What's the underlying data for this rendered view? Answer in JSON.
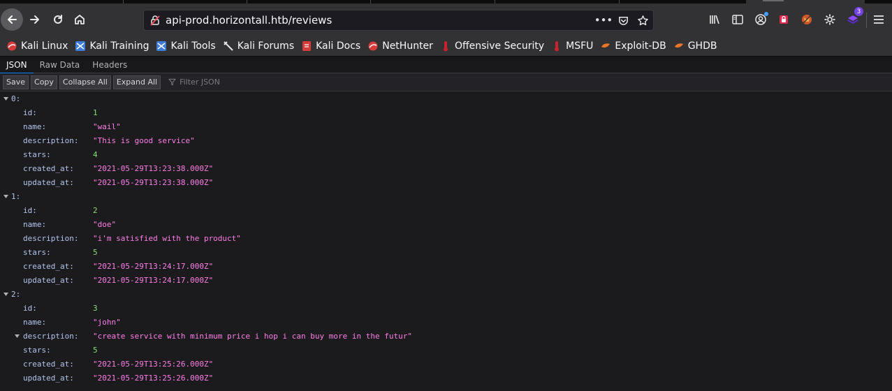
{
  "browser": {
    "url": "api-prod.horizontall.htb/reviews",
    "page_actions": [
      "more-icon",
      "pocket-icon",
      "bookmark-star-icon"
    ],
    "extension_badge": "3"
  },
  "bookmarks": [
    {
      "label": "Kali Linux",
      "icon": "kali-dragon-icon"
    },
    {
      "label": "Kali Training",
      "icon": "kali-training-icon"
    },
    {
      "label": "Kali Tools",
      "icon": "kali-tools-icon"
    },
    {
      "label": "Kali Forums",
      "icon": "kali-forums-icon"
    },
    {
      "label": "Kali Docs",
      "icon": "kali-docs-icon"
    },
    {
      "label": "NetHunter",
      "icon": "nethunter-icon"
    },
    {
      "label": "Offensive Security",
      "icon": "offsec-icon"
    },
    {
      "label": "MSFU",
      "icon": "msfu-icon"
    },
    {
      "label": "Exploit-DB",
      "icon": "exploitdb-icon"
    },
    {
      "label": "GHDB",
      "icon": "ghdb-icon"
    }
  ],
  "viewer": {
    "tabs": [
      "JSON",
      "Raw Data",
      "Headers"
    ],
    "selected_tab": "JSON",
    "toolbar": {
      "save": "Save",
      "copy": "Copy",
      "collapse": "Collapse All",
      "expand": "Expand All",
      "filter_placeholder": "Filter JSON"
    }
  },
  "reviews": [
    {
      "index": "0:",
      "fields": [
        {
          "key": "id:",
          "value": "1",
          "type": "num"
        },
        {
          "key": "name:",
          "value": "\"wail\"",
          "type": "str"
        },
        {
          "key": "description:",
          "value": "\"This is good service\"",
          "type": "str"
        },
        {
          "key": "stars:",
          "value": "4",
          "type": "num"
        },
        {
          "key": "created_at:",
          "value": "\"2021-05-29T13:23:38.000Z\"",
          "type": "str"
        },
        {
          "key": "updated_at:",
          "value": "\"2021-05-29T13:23:38.000Z\"",
          "type": "str"
        }
      ]
    },
    {
      "index": "1:",
      "fields": [
        {
          "key": "id:",
          "value": "2",
          "type": "num"
        },
        {
          "key": "name:",
          "value": "\"doe\"",
          "type": "str"
        },
        {
          "key": "description:",
          "value": "\"i'm satisfied with the product\"",
          "type": "str"
        },
        {
          "key": "stars:",
          "value": "5",
          "type": "num"
        },
        {
          "key": "created_at:",
          "value": "\"2021-05-29T13:24:17.000Z\"",
          "type": "str"
        },
        {
          "key": "updated_at:",
          "value": "\"2021-05-29T13:24:17.000Z\"",
          "type": "str"
        }
      ]
    },
    {
      "index": "2:",
      "fields": [
        {
          "key": "id:",
          "value": "3",
          "type": "num"
        },
        {
          "key": "name:",
          "value": "\"john\"",
          "type": "str"
        },
        {
          "key": "description:",
          "value": "\"create service with minimum price i hop i can buy more in the futur\"",
          "type": "str",
          "expandable": true
        },
        {
          "key": "stars:",
          "value": "5",
          "type": "num"
        },
        {
          "key": "created_at:",
          "value": "\"2021-05-29T13:25:26.000Z\"",
          "type": "str"
        },
        {
          "key": "updated_at:",
          "value": "\"2021-05-29T13:25:26.000Z\"",
          "type": "str"
        }
      ]
    }
  ],
  "colors": {
    "key": "#b4c4ee",
    "number": "#86de74",
    "string": "#ff7de9",
    "accent": "#0a84ff"
  }
}
